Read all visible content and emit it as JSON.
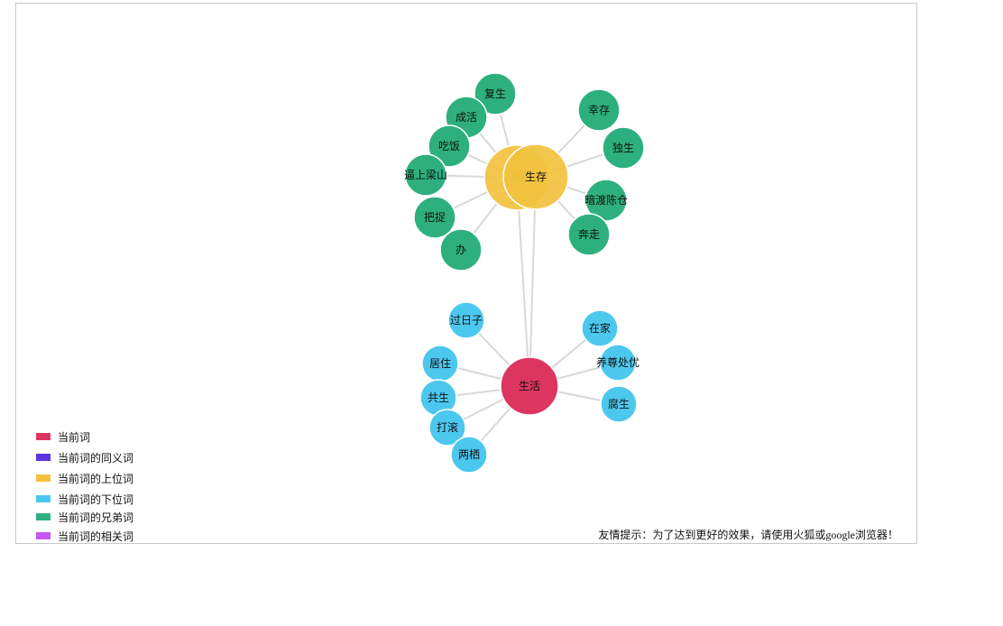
{
  "colors": {
    "current": "#dc3560",
    "synonym": "#5c33e0",
    "hypernym": "#f2c23e",
    "hyponym": "#4cc8ef",
    "sibling": "#2db07e",
    "related": "#c757f0",
    "link": "#d8d8d8"
  },
  "legend": [
    {
      "label": "当前词",
      "color": "#dc3560"
    },
    {
      "label": "当前词的同义词",
      "color": "#5c33e0"
    },
    {
      "label": "当前词的上位词",
      "color": "#f2c23e"
    },
    {
      "label": "当前词的下位词",
      "color": "#4cc8ef"
    },
    {
      "label": "当前词的兄弟词",
      "color": "#2db07e"
    },
    {
      "label": "当前词的相关词",
      "color": "#c757f0"
    }
  ],
  "hint": "友情提示：为了达到更好的效果，请使用火狐或google浏览器！",
  "graph": {
    "nodes": [
      {
        "id": "shenghuo",
        "label": "生活",
        "type": "current"
      },
      {
        "id": "huozhe",
        "label": "活着",
        "type": "hypernym"
      },
      {
        "id": "shengcun",
        "label": "生存",
        "type": "hypernym"
      },
      {
        "id": "fusheng",
        "label": "复生",
        "type": "sibling"
      },
      {
        "id": "chenghuo",
        "label": "成活",
        "type": "sibling"
      },
      {
        "id": "chifan",
        "label": "吃饭",
        "type": "sibling"
      },
      {
        "id": "bishang",
        "label": "逼上梁山",
        "type": "sibling"
      },
      {
        "id": "bazhuo",
        "label": "把捉",
        "type": "sibling"
      },
      {
        "id": "ban",
        "label": "办",
        "type": "sibling"
      },
      {
        "id": "xingcun",
        "label": "幸存",
        "type": "sibling"
      },
      {
        "id": "dusheng",
        "label": "独生",
        "type": "sibling"
      },
      {
        "id": "andu",
        "label": "暗渡陈仓",
        "type": "sibling"
      },
      {
        "id": "benzou",
        "label": "奔走",
        "type": "sibling"
      },
      {
        "id": "guorizi",
        "label": "过日子",
        "type": "hyponym"
      },
      {
        "id": "juzhu",
        "label": "居住",
        "type": "hyponym"
      },
      {
        "id": "gongsheng",
        "label": "共生",
        "type": "hyponym"
      },
      {
        "id": "dagun",
        "label": "打滚",
        "type": "hyponym"
      },
      {
        "id": "liangqi",
        "label": "两栖",
        "type": "hyponym"
      },
      {
        "id": "zaijia",
        "label": "在家",
        "type": "hyponym"
      },
      {
        "id": "yangzun",
        "label": "养尊处优",
        "type": "hyponym"
      },
      {
        "id": "fusheng2",
        "label": "腐生",
        "type": "hyponym"
      }
    ],
    "links": [
      [
        "shenghuo",
        "huozhe"
      ],
      [
        "shenghuo",
        "shengcun"
      ],
      [
        "huozhe",
        "fusheng"
      ],
      [
        "huozhe",
        "chenghuo"
      ],
      [
        "huozhe",
        "chifan"
      ],
      [
        "huozhe",
        "bishang"
      ],
      [
        "huozhe",
        "bazhuo"
      ],
      [
        "huozhe",
        "ban"
      ],
      [
        "shengcun",
        "xingcun"
      ],
      [
        "shengcun",
        "dusheng"
      ],
      [
        "shengcun",
        "andu"
      ],
      [
        "shengcun",
        "benzou"
      ],
      [
        "shenghuo",
        "guorizi"
      ],
      [
        "shenghuo",
        "juzhu"
      ],
      [
        "shenghuo",
        "gongsheng"
      ],
      [
        "shenghuo",
        "dagun"
      ],
      [
        "shenghuo",
        "liangqi"
      ],
      [
        "shenghuo",
        "zaijia"
      ],
      [
        "shenghuo",
        "yangzun"
      ],
      [
        "shenghuo",
        "fusheng2"
      ]
    ]
  }
}
